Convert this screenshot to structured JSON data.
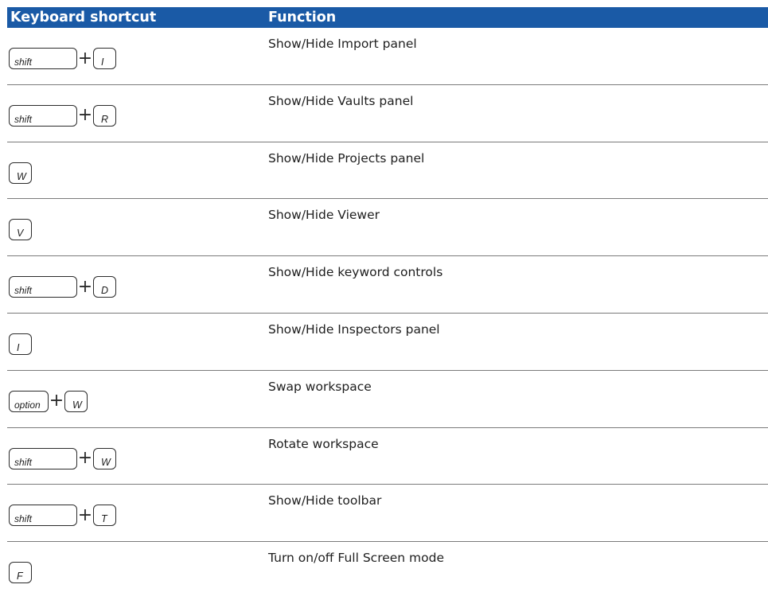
{
  "table": {
    "headers": {
      "shortcut": "Keyboard shortcut",
      "function": "Function"
    },
    "plus_sign": "+",
    "rows": [
      {
        "keys": [
          {
            "label": "shift",
            "type": "shift"
          },
          {
            "label": "I",
            "type": "letter"
          }
        ],
        "function": "Show/Hide Import panel"
      },
      {
        "keys": [
          {
            "label": "shift",
            "type": "shift"
          },
          {
            "label": "R",
            "type": "letter"
          }
        ],
        "function": "Show/Hide Vaults panel"
      },
      {
        "keys": [
          {
            "label": "W",
            "type": "letter"
          }
        ],
        "function": "Show/Hide Projects panel"
      },
      {
        "keys": [
          {
            "label": "V",
            "type": "letter"
          }
        ],
        "function": "Show/Hide Viewer"
      },
      {
        "keys": [
          {
            "label": "shift",
            "type": "shift"
          },
          {
            "label": "D",
            "type": "letter"
          }
        ],
        "function": "Show/Hide keyword controls"
      },
      {
        "keys": [
          {
            "label": "I",
            "type": "letter"
          }
        ],
        "function": "Show/Hide Inspectors panel"
      },
      {
        "keys": [
          {
            "label": "option",
            "type": "option"
          },
          {
            "label": "W",
            "type": "letter"
          }
        ],
        "function": "Swap workspace"
      },
      {
        "keys": [
          {
            "label": "shift",
            "type": "shift"
          },
          {
            "label": "W",
            "type": "letter"
          }
        ],
        "function": "Rotate workspace"
      },
      {
        "keys": [
          {
            "label": "shift",
            "type": "shift"
          },
          {
            "label": "T",
            "type": "letter"
          }
        ],
        "function": "Show/Hide toolbar"
      },
      {
        "keys": [
          {
            "label": "F",
            "type": "letter"
          }
        ],
        "function": "Turn on/off Full Screen mode"
      }
    ]
  },
  "colors": {
    "header_background": "#1a5aa6",
    "header_text": "#ffffff",
    "row_divider": "#7a7a7a",
    "body_text": "#1e1e1e"
  }
}
